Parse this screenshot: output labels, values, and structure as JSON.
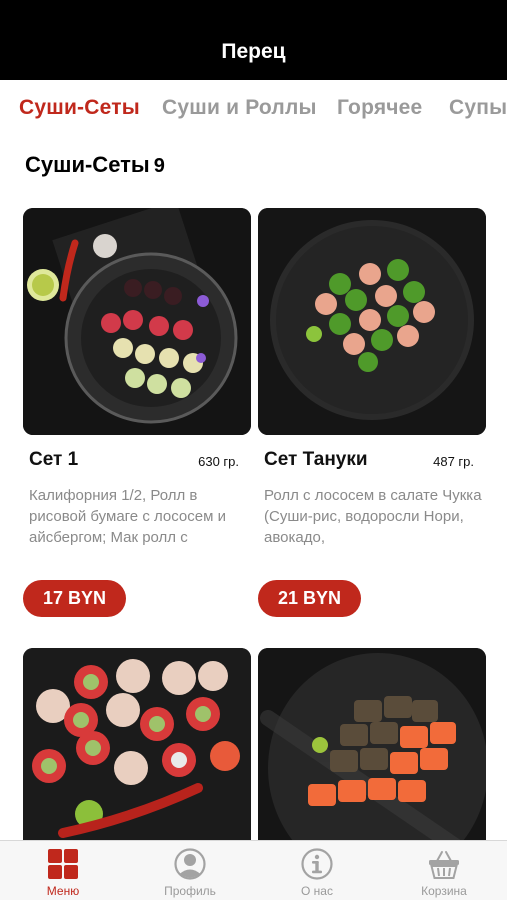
{
  "app_title": "Перец",
  "tabs": [
    {
      "label": "Суши-Сеты",
      "active": true
    },
    {
      "label": "Суши и Роллы",
      "active": false
    },
    {
      "label": "Горячее",
      "active": false
    },
    {
      "label": "Супы",
      "active": false
    }
  ],
  "section": {
    "title": "Суши-Сеты",
    "count": "9"
  },
  "products": [
    {
      "name": "Сет 1",
      "weight": "630 гр.",
      "description": "Калифорния 1/2, Ролл в рисовой бумаге с лососем и айсбергом; Мак ролл с",
      "price": "17 BYN",
      "image": "sushi-set-photo"
    },
    {
      "name": "Сет Тануки",
      "weight": "487 гр.",
      "description": "Ролл с лососем в салате Чукка (Суши-рис, водоросли Нори, авокадо,",
      "price": "21 BYN",
      "image": "sushi-set-photo"
    },
    {
      "image": "sushi-set-photo"
    },
    {
      "image": "sushi-set-photo"
    }
  ],
  "bottom_nav": [
    {
      "label": "Меню",
      "icon": "menu-grid-icon",
      "active": true
    },
    {
      "label": "Профиль",
      "icon": "profile-icon",
      "active": false
    },
    {
      "label": "О нас",
      "icon": "info-icon",
      "active": false
    },
    {
      "label": "Корзина",
      "icon": "basket-icon",
      "active": false
    }
  ],
  "colors": {
    "accent": "#c0281c",
    "topbar": "#000000",
    "inactive": "#9a9a9a"
  }
}
